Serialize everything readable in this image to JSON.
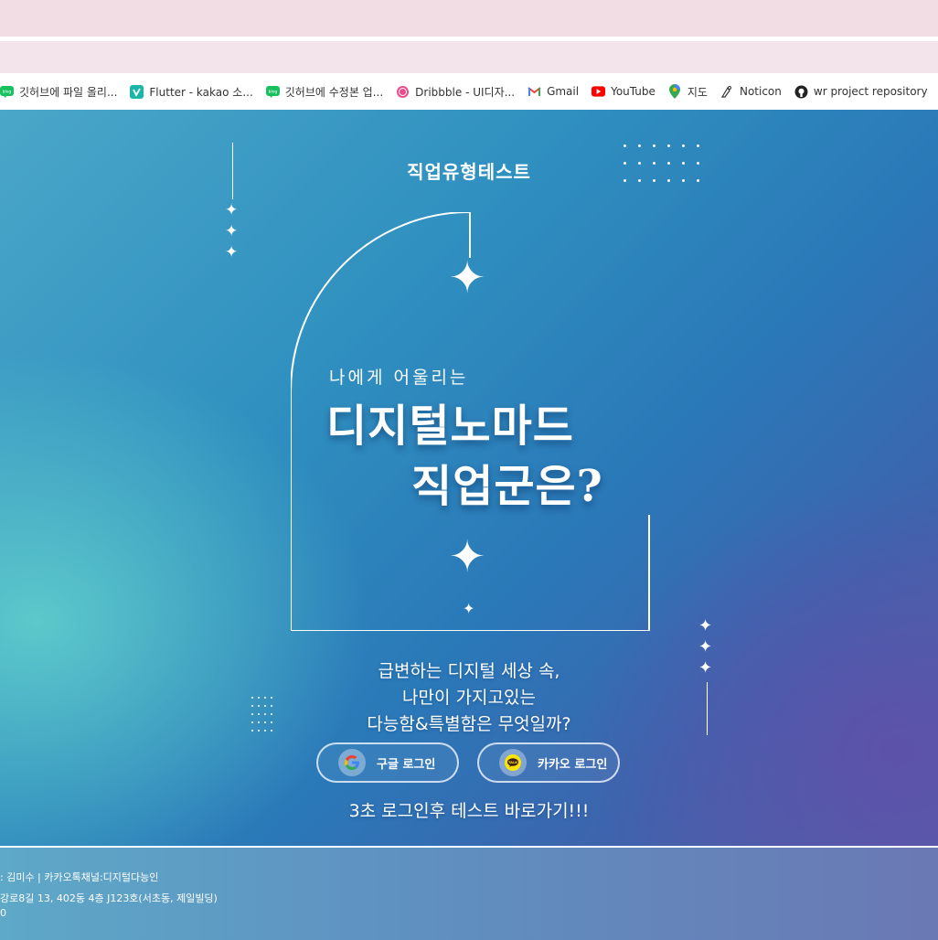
{
  "bookmarks": [
    {
      "icon": "blog-icon",
      "label": "깃허브에 파일 올리..."
    },
    {
      "icon": "vimeo-icon",
      "label": "Flutter - kakao 소..."
    },
    {
      "icon": "blog-icon",
      "label": "깃허브에 수정본 업..."
    },
    {
      "icon": "dribbble-icon",
      "label": "Dribbble - UI디자..."
    },
    {
      "icon": "gmail-icon",
      "label": "Gmail"
    },
    {
      "icon": "youtube-icon",
      "label": "YouTube"
    },
    {
      "icon": "maps-icon",
      "label": "지도"
    },
    {
      "icon": "noticon-icon",
      "label": "Noticon"
    },
    {
      "icon": "github-icon",
      "label": "wr project repository"
    }
  ],
  "hero": {
    "title": "직업유형테스트",
    "subtitle": "나에게 어울리는",
    "headline_1": "디지털노마드",
    "headline_2": "직업군은?",
    "desc_1": "급변하는 디지털 세상 속,",
    "desc_2": "나만이 가지고있는",
    "desc_3": "다능함&특별함은 무엇일까?",
    "google_login": "구글 로그인",
    "kakao_login": "카카오 로그인",
    "cta": "3초 로그인후 테스트 바로가기!!!"
  },
  "footer": {
    "line_1": ": 김미수 | 카카오톡채널:디지털다능인",
    "line_2": "강로8길 13, 402동 4층 J123호(서초동, 제일빌딩)",
    "line_3": "0"
  },
  "colors": {
    "kakao_yellow": "#FEE500",
    "accent_white": "#ffffff"
  }
}
